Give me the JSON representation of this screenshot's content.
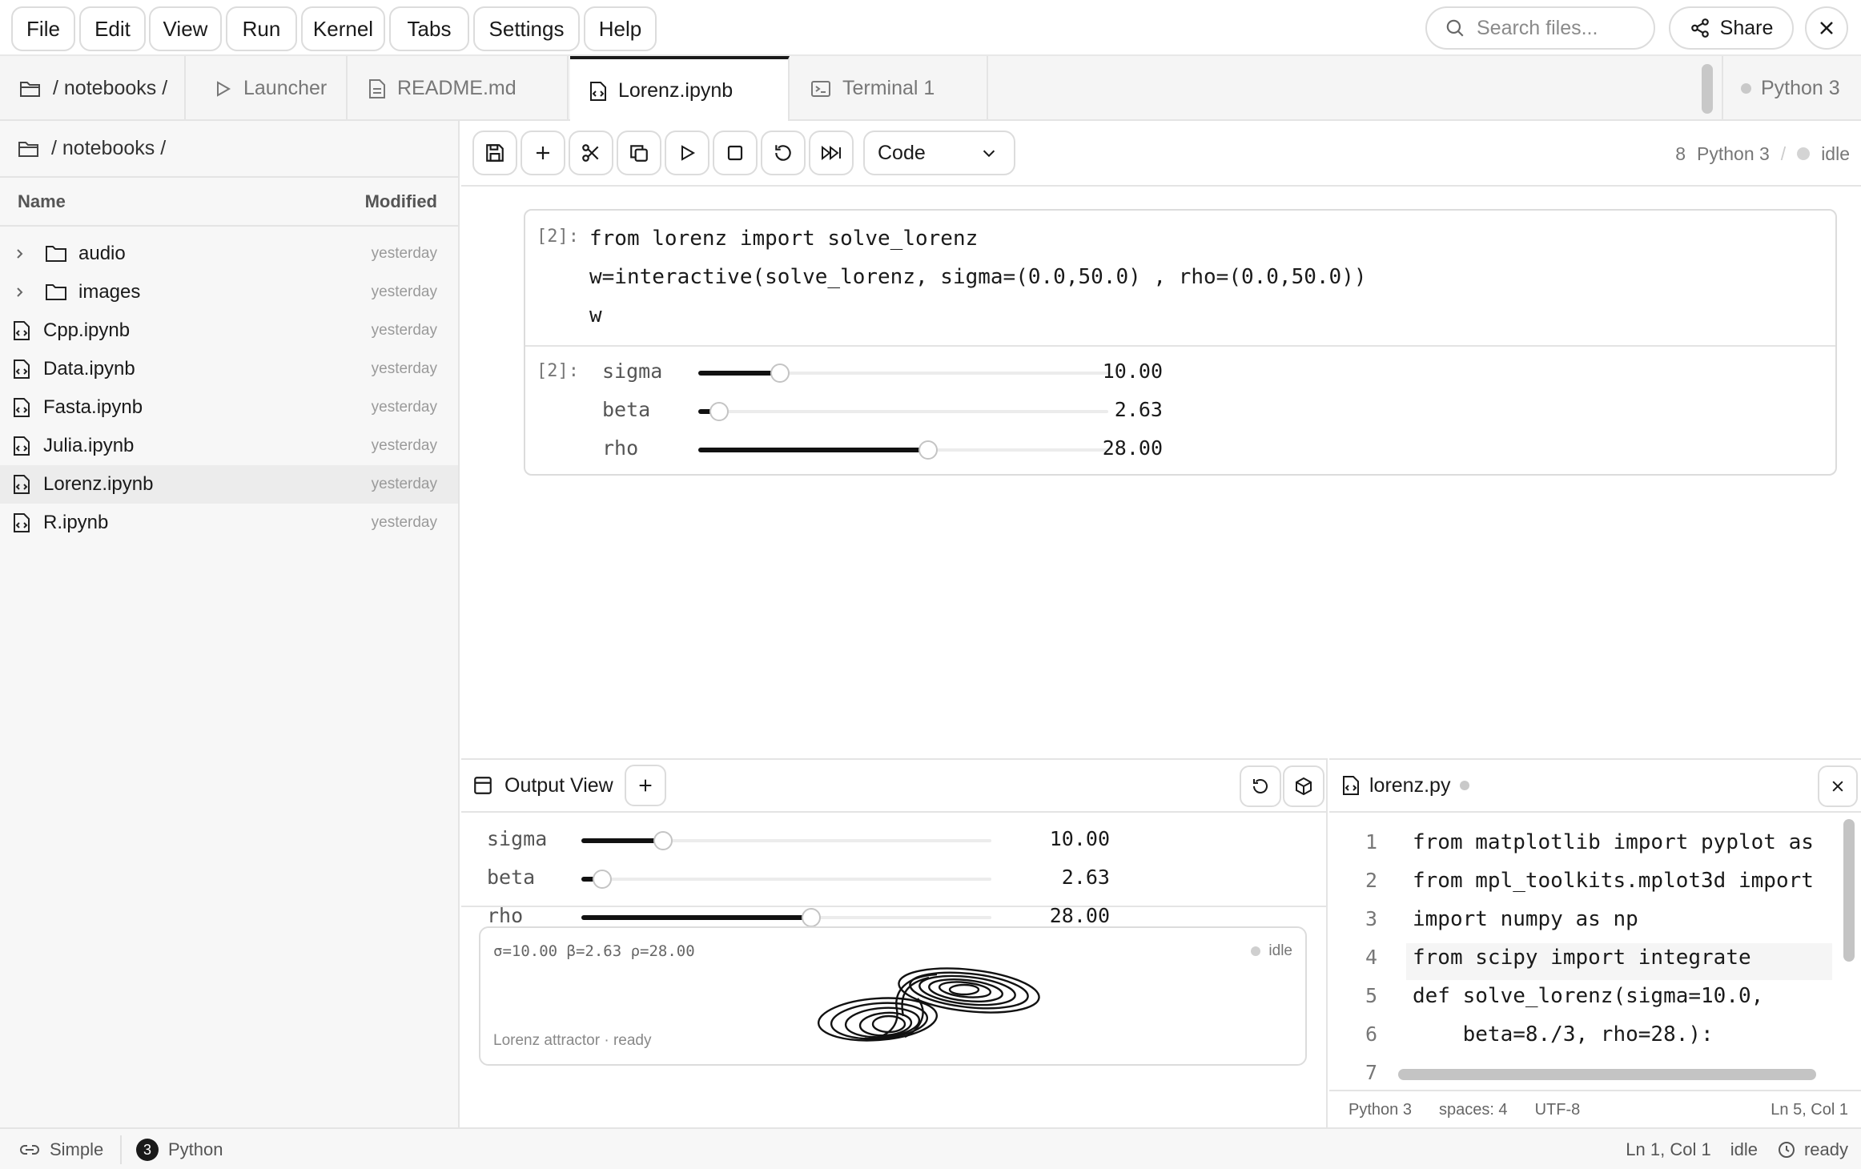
{
  "menubar": {
    "items": [
      "File",
      "Edit",
      "View",
      "Run",
      "Kernel",
      "Tabs",
      "Settings",
      "Help"
    ],
    "search_placeholder": "Search files...",
    "share_label": "Share"
  },
  "tabs": {
    "crumb": "/ notebooks /",
    "items": [
      {
        "label": "Launcher",
        "icon": "play-icon"
      },
      {
        "label": "README.md",
        "icon": "document-icon"
      },
      {
        "label": "Lorenz.ipynb",
        "icon": "notebook-icon"
      },
      {
        "label": "Terminal 1",
        "icon": "terminal-icon"
      }
    ],
    "kernel": "Python 3"
  },
  "filebrowser": {
    "crumb": "/ notebooks /",
    "col_name": "Name",
    "col_modified": "Modified",
    "items": [
      {
        "name": "audio",
        "type": "folder",
        "modified": "yesterday"
      },
      {
        "name": "images",
        "type": "folder",
        "modified": "yesterday"
      },
      {
        "name": "Cpp.ipynb",
        "type": "notebook",
        "modified": "yesterday"
      },
      {
        "name": "Data.ipynb",
        "type": "notebook",
        "modified": "yesterday"
      },
      {
        "name": "Fasta.ipynb",
        "type": "notebook",
        "modified": "yesterday"
      },
      {
        "name": "Julia.ipynb",
        "type": "notebook",
        "modified": "yesterday"
      },
      {
        "name": "Lorenz.ipynb",
        "type": "notebook",
        "modified": "yesterday",
        "selected": true
      },
      {
        "name": "R.ipynb",
        "type": "notebook",
        "modified": "yesterday"
      }
    ]
  },
  "notebook": {
    "cell_type": "Code",
    "kernel_count": "8",
    "kernel_name": "Python 3",
    "kernel_sep": "/",
    "kernel_state": "idle",
    "cell": {
      "in_prompt": "[2]:",
      "out_prompt": "[2]:",
      "code": [
        "from lorenz import solve_lorenz",
        "w=interactive(solve_lorenz, sigma=(0.0,50.0) , rho=(0.0,50.0))",
        "w"
      ]
    }
  },
  "widgets": [
    {
      "label": "sigma",
      "value": "10.00",
      "level": 0.2
    },
    {
      "label": "beta",
      "value": "2.63",
      "level": 0.05
    },
    {
      "label": "rho",
      "value": "28.00",
      "level": 0.56
    }
  ],
  "output_view": {
    "title": "Output View",
    "plot_params": "σ=10.00 β=2.63 ρ=28.00",
    "plot_state": "idle",
    "plot_caption": "Lorenz attractor · ready"
  },
  "editor": {
    "filename": "lorenz.py",
    "lines": [
      {
        "n": "1",
        "code": "from matplotlib import pyplot as"
      },
      {
        "n": "2",
        "code": "from mpl_toolkits.mplot3d import"
      },
      {
        "n": "3",
        "code": "import numpy as np"
      },
      {
        "n": "4",
        "code": "from scipy import integrate"
      },
      {
        "n": "5",
        "code": "def solve_lorenz(sigma=10.0,"
      },
      {
        "n": "6",
        "code": "    beta=8./3, rho=28.):"
      },
      {
        "n": "7",
        "code": ""
      }
    ],
    "status": {
      "lang": "Python 3",
      "spaces": "spaces: 4",
      "encoding": "UTF-8",
      "position": "Ln 5, Col 1"
    }
  },
  "statusbar": {
    "mode": "Simple",
    "kernel_badge": "3",
    "kernel": "Python",
    "position": "Ln 1, Col 1",
    "state": "idle",
    "ready": "ready"
  },
  "colors": {
    "accent": "#1a1a1a",
    "border": "#e4e4e4",
    "muted": "#777777"
  }
}
